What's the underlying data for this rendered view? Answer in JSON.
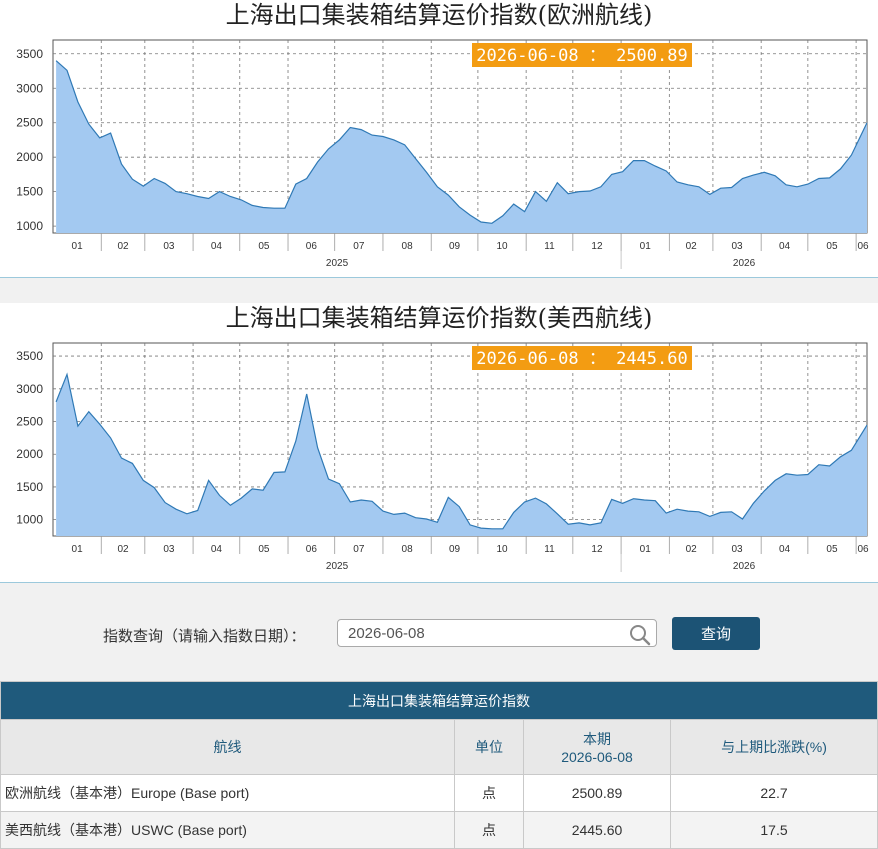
{
  "charts": [
    {
      "title": "上海出口集装箱结算运价指数(欧洲航线)",
      "tooltip": "2026-06-08 ： 2500.89",
      "month_labels": [
        "01",
        "02",
        "03",
        "04",
        "05",
        "06",
        "07",
        "08",
        "09",
        "10",
        "11",
        "12",
        "01",
        "02",
        "03",
        "04",
        "05",
        "06"
      ],
      "year_labels": [
        "2025",
        "2026"
      ]
    },
    {
      "title": "上海出口集装箱结算运价指数(美西航线)",
      "tooltip": "2026-06-08 ： 2445.60",
      "month_labels": [
        "01",
        "02",
        "03",
        "04",
        "05",
        "06",
        "07",
        "08",
        "09",
        "10",
        "11",
        "12",
        "01",
        "02",
        "03",
        "04",
        "05",
        "06"
      ],
      "year_labels": [
        "2025",
        "2026"
      ]
    }
  ],
  "chart_data": [
    {
      "type": "area",
      "title": "上海出口集装箱结算运价指数(欧洲航线)",
      "x_unit": "week",
      "x_range": [
        "2025-01-01",
        "2026-06-08"
      ],
      "ylim": [
        900,
        3700
      ],
      "yticks": [
        1000,
        1500,
        2000,
        2500,
        3000,
        3500
      ],
      "grid": true,
      "fill_color": "#a3c9f1",
      "line_color": "#2f79b5",
      "points": [
        [
          "2025-01-03",
          3400
        ],
        [
          "2025-01-10",
          3260
        ],
        [
          "2025-01-17",
          2800
        ],
        [
          "2025-01-24",
          2480
        ],
        [
          "2025-01-31",
          2280
        ],
        [
          "2025-02-07",
          2350
        ],
        [
          "2025-02-14",
          1900
        ],
        [
          "2025-02-21",
          1680
        ],
        [
          "2025-02-28",
          1580
        ],
        [
          "2025-03-07",
          1690
        ],
        [
          "2025-03-14",
          1620
        ],
        [
          "2025-03-21",
          1500
        ],
        [
          "2025-03-28",
          1470
        ],
        [
          "2025-04-04",
          1430
        ],
        [
          "2025-04-11",
          1400
        ],
        [
          "2025-04-18",
          1500
        ],
        [
          "2025-04-25",
          1430
        ],
        [
          "2025-05-02",
          1380
        ],
        [
          "2025-05-09",
          1300
        ],
        [
          "2025-05-16",
          1270
        ],
        [
          "2025-05-23",
          1260
        ],
        [
          "2025-05-30",
          1260
        ],
        [
          "2025-06-06",
          1610
        ],
        [
          "2025-06-13",
          1690
        ],
        [
          "2025-06-20",
          1930
        ],
        [
          "2025-06-27",
          2120
        ],
        [
          "2025-07-04",
          2250
        ],
        [
          "2025-07-11",
          2430
        ],
        [
          "2025-07-18",
          2400
        ],
        [
          "2025-07-25",
          2320
        ],
        [
          "2025-08-01",
          2300
        ],
        [
          "2025-08-08",
          2250
        ],
        [
          "2025-08-15",
          2180
        ],
        [
          "2025-08-22",
          1980
        ],
        [
          "2025-08-29",
          1780
        ],
        [
          "2025-09-05",
          1570
        ],
        [
          "2025-09-12",
          1450
        ],
        [
          "2025-09-19",
          1280
        ],
        [
          "2025-09-26",
          1160
        ],
        [
          "2025-10-03",
          1060
        ],
        [
          "2025-10-10",
          1040
        ],
        [
          "2025-10-17",
          1150
        ],
        [
          "2025-10-24",
          1320
        ],
        [
          "2025-10-31",
          1210
        ],
        [
          "2025-11-07",
          1500
        ],
        [
          "2025-11-14",
          1360
        ],
        [
          "2025-11-21",
          1630
        ],
        [
          "2025-11-28",
          1470
        ],
        [
          "2025-12-05",
          1500
        ],
        [
          "2025-12-12",
          1510
        ],
        [
          "2025-12-19",
          1570
        ],
        [
          "2025-12-26",
          1750
        ],
        [
          "2026-01-02",
          1790
        ],
        [
          "2026-01-09",
          1950
        ],
        [
          "2026-01-16",
          1950
        ],
        [
          "2026-01-23",
          1870
        ],
        [
          "2026-01-30",
          1800
        ],
        [
          "2026-02-06",
          1640
        ],
        [
          "2026-02-13",
          1600
        ],
        [
          "2026-02-20",
          1570
        ],
        [
          "2026-02-27",
          1460
        ],
        [
          "2026-03-06",
          1550
        ],
        [
          "2026-03-13",
          1560
        ],
        [
          "2026-03-20",
          1690
        ],
        [
          "2026-03-27",
          1740
        ],
        [
          "2026-04-03",
          1780
        ],
        [
          "2026-04-10",
          1730
        ],
        [
          "2026-04-17",
          1600
        ],
        [
          "2026-04-24",
          1570
        ],
        [
          "2026-05-01",
          1610
        ],
        [
          "2026-05-08",
          1690
        ],
        [
          "2026-05-15",
          1700
        ],
        [
          "2026-05-22",
          1830
        ],
        [
          "2026-05-29",
          2030
        ],
        [
          "2026-06-08",
          2500.89
        ]
      ]
    },
    {
      "type": "area",
      "title": "上海出口集装箱结算运价指数(美西航线)",
      "x_unit": "week",
      "x_range": [
        "2025-01-01",
        "2026-06-08"
      ],
      "ylim": [
        750,
        3700
      ],
      "yticks": [
        1000,
        1500,
        2000,
        2500,
        3000,
        3500
      ],
      "grid": true,
      "fill_color": "#a3c9f1",
      "line_color": "#2f79b5",
      "points": [
        [
          "2025-01-03",
          2800
        ],
        [
          "2025-01-10",
          3220
        ],
        [
          "2025-01-17",
          2430
        ],
        [
          "2025-01-24",
          2650
        ],
        [
          "2025-01-31",
          2460
        ],
        [
          "2025-02-07",
          2250
        ],
        [
          "2025-02-14",
          1940
        ],
        [
          "2025-02-21",
          1860
        ],
        [
          "2025-02-28",
          1600
        ],
        [
          "2025-03-07",
          1490
        ],
        [
          "2025-03-14",
          1260
        ],
        [
          "2025-03-21",
          1160
        ],
        [
          "2025-03-28",
          1090
        ],
        [
          "2025-04-04",
          1140
        ],
        [
          "2025-04-11",
          1600
        ],
        [
          "2025-04-18",
          1370
        ],
        [
          "2025-04-25",
          1220
        ],
        [
          "2025-05-02",
          1330
        ],
        [
          "2025-05-09",
          1470
        ],
        [
          "2025-05-16",
          1450
        ],
        [
          "2025-05-23",
          1720
        ],
        [
          "2025-05-30",
          1730
        ],
        [
          "2025-06-06",
          2200
        ],
        [
          "2025-06-13",
          2920
        ],
        [
          "2025-06-20",
          2100
        ],
        [
          "2025-06-27",
          1620
        ],
        [
          "2025-07-04",
          1550
        ],
        [
          "2025-07-11",
          1270
        ],
        [
          "2025-07-18",
          1300
        ],
        [
          "2025-07-25",
          1280
        ],
        [
          "2025-08-01",
          1130
        ],
        [
          "2025-08-08",
          1080
        ],
        [
          "2025-08-15",
          1100
        ],
        [
          "2025-08-22",
          1030
        ],
        [
          "2025-08-29",
          1010
        ],
        [
          "2025-09-05",
          960
        ],
        [
          "2025-09-12",
          1340
        ],
        [
          "2025-09-19",
          1200
        ],
        [
          "2025-09-26",
          920
        ],
        [
          "2025-10-03",
          870
        ],
        [
          "2025-10-10",
          860
        ],
        [
          "2025-10-17",
          860
        ],
        [
          "2025-10-24",
          1110
        ],
        [
          "2025-10-31",
          1270
        ],
        [
          "2025-11-07",
          1330
        ],
        [
          "2025-11-14",
          1240
        ],
        [
          "2025-11-21",
          1090
        ],
        [
          "2025-11-28",
          930
        ],
        [
          "2025-12-05",
          950
        ],
        [
          "2025-12-12",
          920
        ],
        [
          "2025-12-19",
          950
        ],
        [
          "2025-12-26",
          1310
        ],
        [
          "2026-01-02",
          1250
        ],
        [
          "2026-01-09",
          1320
        ],
        [
          "2026-01-16",
          1300
        ],
        [
          "2026-01-23",
          1290
        ],
        [
          "2026-01-30",
          1100
        ],
        [
          "2026-02-06",
          1160
        ],
        [
          "2026-02-13",
          1130
        ],
        [
          "2026-02-20",
          1120
        ],
        [
          "2026-02-27",
          1050
        ],
        [
          "2026-03-06",
          1110
        ],
        [
          "2026-03-13",
          1120
        ],
        [
          "2026-03-20",
          1010
        ],
        [
          "2026-03-27",
          1250
        ],
        [
          "2026-04-03",
          1440
        ],
        [
          "2026-04-10",
          1600
        ],
        [
          "2026-04-17",
          1700
        ],
        [
          "2026-04-24",
          1680
        ],
        [
          "2026-05-01",
          1690
        ],
        [
          "2026-05-08",
          1840
        ],
        [
          "2026-05-15",
          1820
        ],
        [
          "2026-05-22",
          1960
        ],
        [
          "2026-05-29",
          2060
        ],
        [
          "2026-06-08",
          2445.6
        ]
      ]
    }
  ],
  "query": {
    "label": "指数查询（请输入指数日期）：",
    "date_value": "2026-06-08",
    "button_label": "查询"
  },
  "table": {
    "title": "上海出口集装箱结算运价指数",
    "headers": {
      "route": "航线",
      "unit": "单位",
      "current_line1": "本期",
      "current_line2": "2026-06-08",
      "change": "与上期比涨跌(%)"
    },
    "rows": [
      {
        "route": "欧洲航线（基本港）Europe (Base port)",
        "unit": "点",
        "value": "2500.89",
        "change": "22.7"
      },
      {
        "route": "美西航线（基本港）USWC (Base port)",
        "unit": "点",
        "value": "2445.60",
        "change": "17.5"
      }
    ]
  },
  "colors": {
    "header_bar": "#1f5a7c",
    "button": "#1c5375",
    "tooltip_bg": "#f39c12",
    "area_fill": "#a3c9f1",
    "area_line": "#2f79b5"
  }
}
